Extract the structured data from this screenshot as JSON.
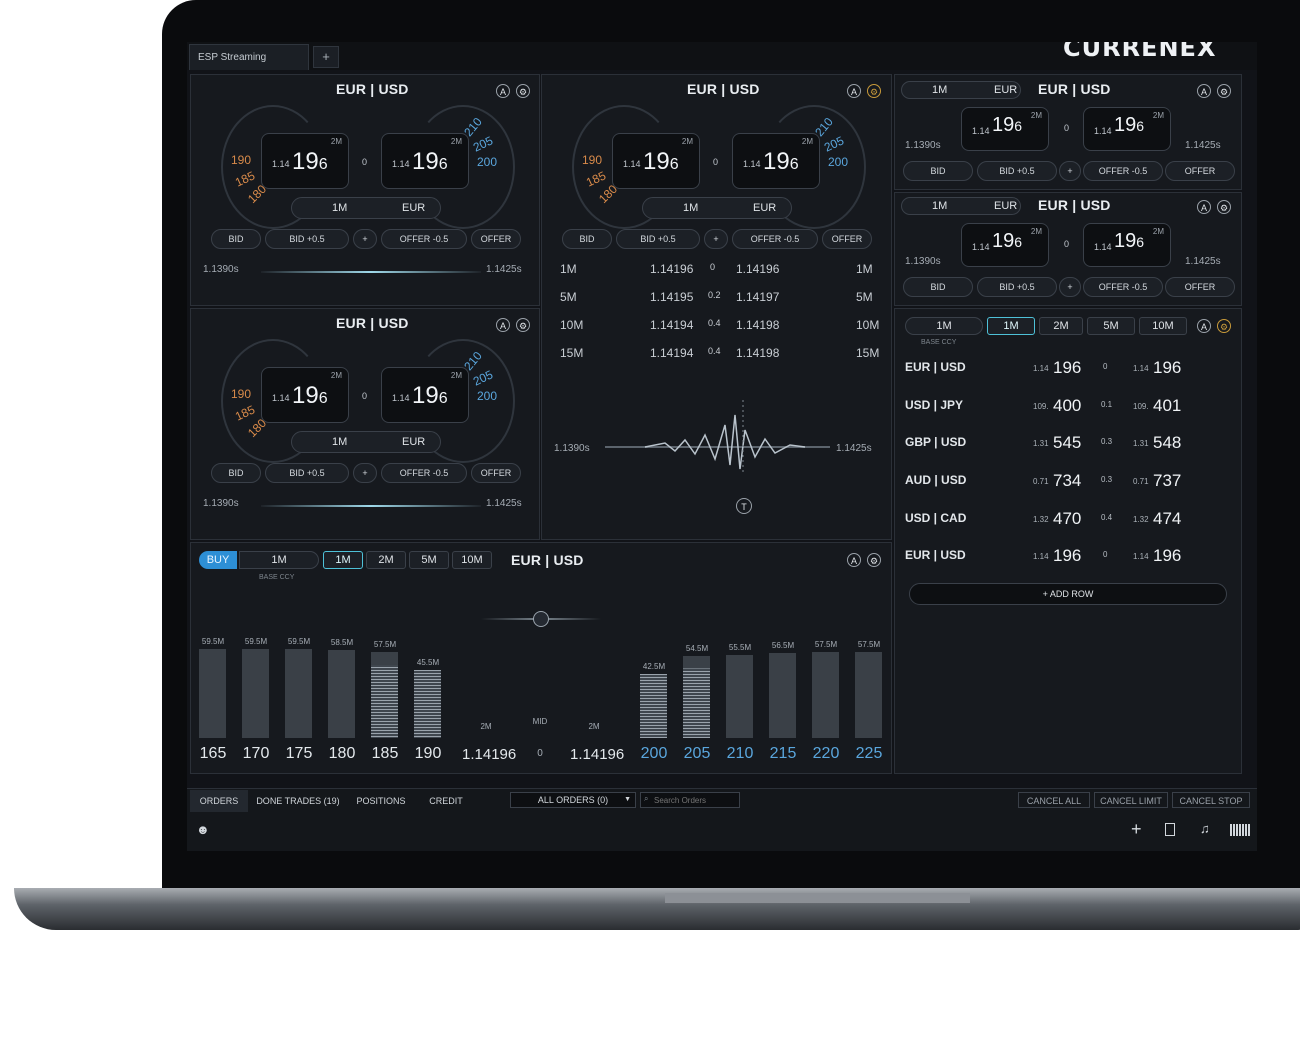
{
  "brand": "CURRENEX",
  "tabs": [
    {
      "label": "ESP Streaming"
    },
    {
      "label": "+"
    }
  ],
  "tile_large": {
    "pair": "EUR | USD",
    "bid": {
      "prefix": "1.14",
      "big": "19",
      "pip": "6",
      "size": "2M"
    },
    "offer": {
      "prefix": "1.14",
      "big": "19",
      "pip": "6",
      "size": "2M"
    },
    "spread": "0",
    "left_ticks": [
      "190",
      "185",
      "180"
    ],
    "right_ticks": [
      "210",
      "205",
      "200"
    ],
    "amount": "1M",
    "ccy": "EUR",
    "buttons": [
      "BID",
      "BID +0.5",
      "+",
      "OFFER -0.5",
      "OFFER"
    ],
    "low": "1.1390s",
    "high": "1.1425s"
  },
  "ladder": {
    "pair": "EUR | USD",
    "rows": [
      {
        "tenor": "1M",
        "bid": "1.14196",
        "spread": "0",
        "offer": "1.14196"
      },
      {
        "tenor": "5M",
        "bid": "1.14195",
        "spread": "0.2",
        "offer": "1.14197"
      },
      {
        "tenor": "10M",
        "bid": "1.14194",
        "spread": "0.4",
        "offer": "1.14198"
      },
      {
        "tenor": "15M",
        "bid": "1.14194",
        "spread": "0.4",
        "offer": "1.14198"
      }
    ],
    "low": "1.1390s",
    "high": "1.1425s"
  },
  "mini": {
    "pair": "EUR | USD",
    "amount": "1M",
    "ccy": "EUR",
    "low": "1.1390s",
    "high": "1.1425s",
    "buttons": [
      "BID",
      "BID +0.5",
      "+",
      "OFFER -0.5",
      "OFFER"
    ]
  },
  "watchlist": {
    "tenors": [
      "1M",
      "1M",
      "2M",
      "5M",
      "10M"
    ],
    "base_ccy": "BASE CCY",
    "rows": [
      {
        "pair": "EUR | USD",
        "bid_pre": "1.14",
        "bid": "196",
        "spread": "0",
        "offer_pre": "1.14",
        "offer": "196"
      },
      {
        "pair": "USD | JPY",
        "bid_pre": "109.",
        "bid": "400",
        "spread": "0.1",
        "offer_pre": "109.",
        "offer": "401"
      },
      {
        "pair": "GBP | USD",
        "bid_pre": "1.31",
        "bid": "545",
        "spread": "0.3",
        "offer_pre": "1.31",
        "offer": "548"
      },
      {
        "pair": "AUD | USD",
        "bid_pre": "0.71",
        "bid": "734",
        "spread": "0.3",
        "offer_pre": "0.71",
        "offer": "737"
      },
      {
        "pair": "USD | CAD",
        "bid_pre": "1.32",
        "bid": "470",
        "spread": "0.4",
        "offer_pre": "1.32",
        "offer": "474"
      },
      {
        "pair": "EUR | USD",
        "bid_pre": "1.14",
        "bid": "196",
        "spread": "0",
        "offer_pre": "1.14",
        "offer": "196"
      }
    ],
    "add_row": "+ ADD ROW"
  },
  "depth": {
    "side": "BUY",
    "amount": "1M",
    "base_ccy": "BASE CCY",
    "tenors": [
      "1M",
      "2M",
      "5M",
      "10M"
    ],
    "pair": "EUR | USD",
    "bid_bars": [
      {
        "size": "59.5M",
        "tick": "165",
        "fill": 0.0
      },
      {
        "size": "59.5M",
        "tick": "170",
        "fill": 0.0
      },
      {
        "size": "59.5M",
        "tick": "175",
        "fill": 0.0
      },
      {
        "size": "58.5M",
        "tick": "180",
        "fill": 0.0
      },
      {
        "size": "57.5M",
        "tick": "185",
        "fill": 0.85
      },
      {
        "size": "45.5M",
        "tick": "190",
        "fill": 1.0
      }
    ],
    "ask_bars": [
      {
        "size": "42.5M",
        "tick": "200",
        "fill": 1.0
      },
      {
        "size": "54.5M",
        "tick": "205",
        "fill": 0.85
      },
      {
        "size": "55.5M",
        "tick": "210",
        "fill": 0.0
      },
      {
        "size": "56.5M",
        "tick": "215",
        "fill": 0.0
      },
      {
        "size": "57.5M",
        "tick": "220",
        "fill": 0.0
      },
      {
        "size": "57.5M",
        "tick": "225",
        "fill": 0.0
      }
    ],
    "bid_mid": {
      "size": "2M",
      "price": "1.14196"
    },
    "mid_label": "MID",
    "mid_value": "0",
    "ask_mid": {
      "size": "2M",
      "price": "1.14196"
    }
  },
  "bottom": {
    "tabs": [
      "ORDERS",
      "DONE TRADES (19)",
      "POSITIONS",
      "CREDIT"
    ],
    "filter": "ALL ORDERS (0)",
    "search_placeholder": "Search Orders",
    "actions": [
      "CANCEL ALL",
      "CANCEL LIMIT",
      "CANCEL STOP"
    ]
  },
  "colors": {
    "accent": "#4ec1d8",
    "buy": "#2d8fd6",
    "bid_ticks": "#d88a4a",
    "ask_ticks": "#5aa6dd"
  }
}
